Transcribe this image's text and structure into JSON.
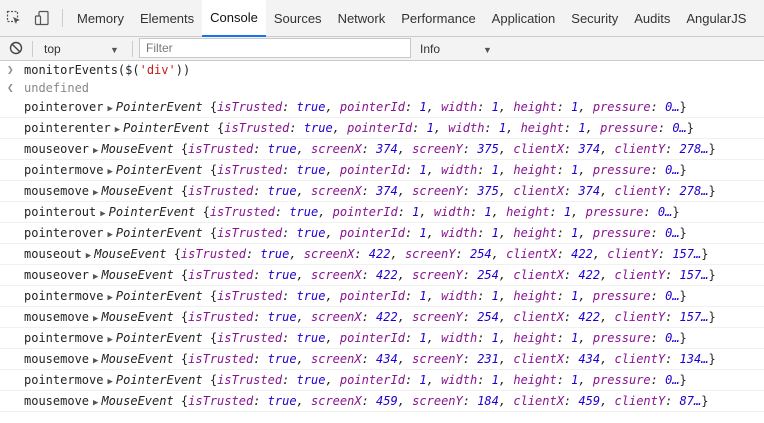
{
  "tabs": [
    {
      "label": "Memory"
    },
    {
      "label": "Elements"
    },
    {
      "label": "Console",
      "active": true
    },
    {
      "label": "Sources"
    },
    {
      "label": "Network"
    },
    {
      "label": "Performance"
    },
    {
      "label": "Application"
    },
    {
      "label": "Security"
    },
    {
      "label": "Audits"
    },
    {
      "label": "AngularJS"
    }
  ],
  "toolbar": {
    "context": "top",
    "filter_placeholder": "Filter",
    "level": "Info"
  },
  "console": {
    "command_prefix": "monitorEvents($(",
    "command_arg": "'div'",
    "command_suffix": "))",
    "result": "undefined",
    "events": [
      {
        "name": "pointerover",
        "type": "PointerEvent",
        "props": [
          [
            "isTrusted",
            "true"
          ],
          [
            "pointerId",
            "1"
          ],
          [
            "width",
            "1"
          ],
          [
            "height",
            "1"
          ],
          [
            "pressure",
            "0…"
          ]
        ]
      },
      {
        "name": "pointerenter",
        "type": "PointerEvent",
        "props": [
          [
            "isTrusted",
            "true"
          ],
          [
            "pointerId",
            "1"
          ],
          [
            "width",
            "1"
          ],
          [
            "height",
            "1"
          ],
          [
            "pressure",
            "0…"
          ]
        ]
      },
      {
        "name": "mouseover",
        "type": "MouseEvent",
        "props": [
          [
            "isTrusted",
            "true"
          ],
          [
            "screenX",
            "374"
          ],
          [
            "screenY",
            "375"
          ],
          [
            "clientX",
            "374"
          ],
          [
            "clientY",
            "278…"
          ]
        ]
      },
      {
        "name": "pointermove",
        "type": "PointerEvent",
        "props": [
          [
            "isTrusted",
            "true"
          ],
          [
            "pointerId",
            "1"
          ],
          [
            "width",
            "1"
          ],
          [
            "height",
            "1"
          ],
          [
            "pressure",
            "0…"
          ]
        ]
      },
      {
        "name": "mousemove",
        "type": "MouseEvent",
        "props": [
          [
            "isTrusted",
            "true"
          ],
          [
            "screenX",
            "374"
          ],
          [
            "screenY",
            "375"
          ],
          [
            "clientX",
            "374"
          ],
          [
            "clientY",
            "278…"
          ]
        ]
      },
      {
        "name": "pointerout",
        "type": "PointerEvent",
        "props": [
          [
            "isTrusted",
            "true"
          ],
          [
            "pointerId",
            "1"
          ],
          [
            "width",
            "1"
          ],
          [
            "height",
            "1"
          ],
          [
            "pressure",
            "0…"
          ]
        ]
      },
      {
        "name": "pointerover",
        "type": "PointerEvent",
        "props": [
          [
            "isTrusted",
            "true"
          ],
          [
            "pointerId",
            "1"
          ],
          [
            "width",
            "1"
          ],
          [
            "height",
            "1"
          ],
          [
            "pressure",
            "0…"
          ]
        ]
      },
      {
        "name": "mouseout",
        "type": "MouseEvent",
        "props": [
          [
            "isTrusted",
            "true"
          ],
          [
            "screenX",
            "422"
          ],
          [
            "screenY",
            "254"
          ],
          [
            "clientX",
            "422"
          ],
          [
            "clientY",
            "157…"
          ]
        ]
      },
      {
        "name": "mouseover",
        "type": "MouseEvent",
        "props": [
          [
            "isTrusted",
            "true"
          ],
          [
            "screenX",
            "422"
          ],
          [
            "screenY",
            "254"
          ],
          [
            "clientX",
            "422"
          ],
          [
            "clientY",
            "157…"
          ]
        ]
      },
      {
        "name": "pointermove",
        "type": "PointerEvent",
        "props": [
          [
            "isTrusted",
            "true"
          ],
          [
            "pointerId",
            "1"
          ],
          [
            "width",
            "1"
          ],
          [
            "height",
            "1"
          ],
          [
            "pressure",
            "0…"
          ]
        ]
      },
      {
        "name": "mousemove",
        "type": "MouseEvent",
        "props": [
          [
            "isTrusted",
            "true"
          ],
          [
            "screenX",
            "422"
          ],
          [
            "screenY",
            "254"
          ],
          [
            "clientX",
            "422"
          ],
          [
            "clientY",
            "157…"
          ]
        ]
      },
      {
        "name": "pointermove",
        "type": "PointerEvent",
        "props": [
          [
            "isTrusted",
            "true"
          ],
          [
            "pointerId",
            "1"
          ],
          [
            "width",
            "1"
          ],
          [
            "height",
            "1"
          ],
          [
            "pressure",
            "0…"
          ]
        ]
      },
      {
        "name": "mousemove",
        "type": "MouseEvent",
        "props": [
          [
            "isTrusted",
            "true"
          ],
          [
            "screenX",
            "434"
          ],
          [
            "screenY",
            "231"
          ],
          [
            "clientX",
            "434"
          ],
          [
            "clientY",
            "134…"
          ]
        ]
      },
      {
        "name": "pointermove",
        "type": "PointerEvent",
        "props": [
          [
            "isTrusted",
            "true"
          ],
          [
            "pointerId",
            "1"
          ],
          [
            "width",
            "1"
          ],
          [
            "height",
            "1"
          ],
          [
            "pressure",
            "0…"
          ]
        ]
      },
      {
        "name": "mousemove",
        "type": "MouseEvent",
        "props": [
          [
            "isTrusted",
            "true"
          ],
          [
            "screenX",
            "459"
          ],
          [
            "screenY",
            "184"
          ],
          [
            "clientX",
            "459"
          ],
          [
            "clientY",
            "87…"
          ]
        ]
      }
    ]
  }
}
